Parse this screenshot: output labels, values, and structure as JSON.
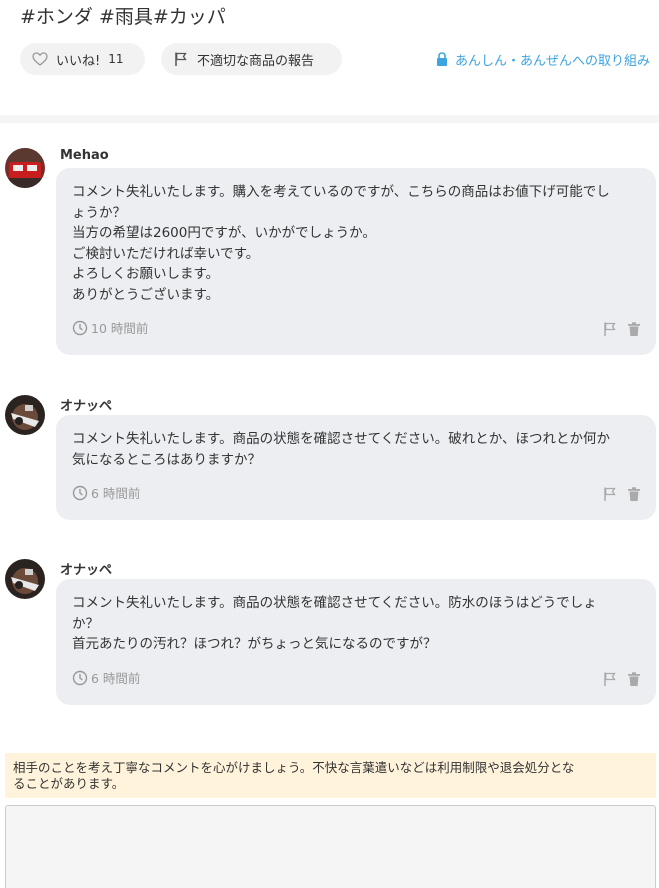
{
  "item": {
    "tags": "#ホンダ #雨具#カッパ"
  },
  "actions": {
    "like_label": "いいね!",
    "like_count": "11",
    "report_label": "不適切な商品の報告",
    "safety_label": "あんしん・あんぜんへの取り組み",
    "accent_color": "#3ca4e0"
  },
  "comments": [
    {
      "author": "Mehao",
      "lines": [
        "コメント失礼いたします。購入を考えているのですが、こちらの商品はお値下げ可能でし",
        "ょうか？",
        "当方の希望は2600円ですが、いかがでしょうか。",
        "ご検討いただければ幸いです。",
        "よろしくお願いします。",
        "ありがとうございます。"
      ],
      "time": "10 時間前",
      "avatar_icon": "avatar-red-car"
    },
    {
      "author": "オナッペ",
      "lines": [
        "コメント失礼いたします。商品の状態を確認させてください。破れとか、ほつれとか何か",
        "気になるところはありますか？"
      ],
      "time": "6 時間前",
      "avatar_icon": "avatar-motorcycle"
    },
    {
      "author": "オナッペ",
      "lines": [
        "コメント失礼いたします。商品の状態を確認させてください。防水のほうはどうでしょ",
        "か？",
        "首元あたりの汚れ？ほつれ？がちょっと気になるのですが？"
      ],
      "time": "6 時間前",
      "avatar_icon": "avatar-motorcycle"
    }
  ],
  "notice": {
    "line1": "相手のことを考え丁寧なコメントを心がけましょう。不快な言葉遣いなどは利用制限や退会処分とな",
    "line2": "ることがあります。"
  },
  "comment_input": {
    "value": ""
  }
}
